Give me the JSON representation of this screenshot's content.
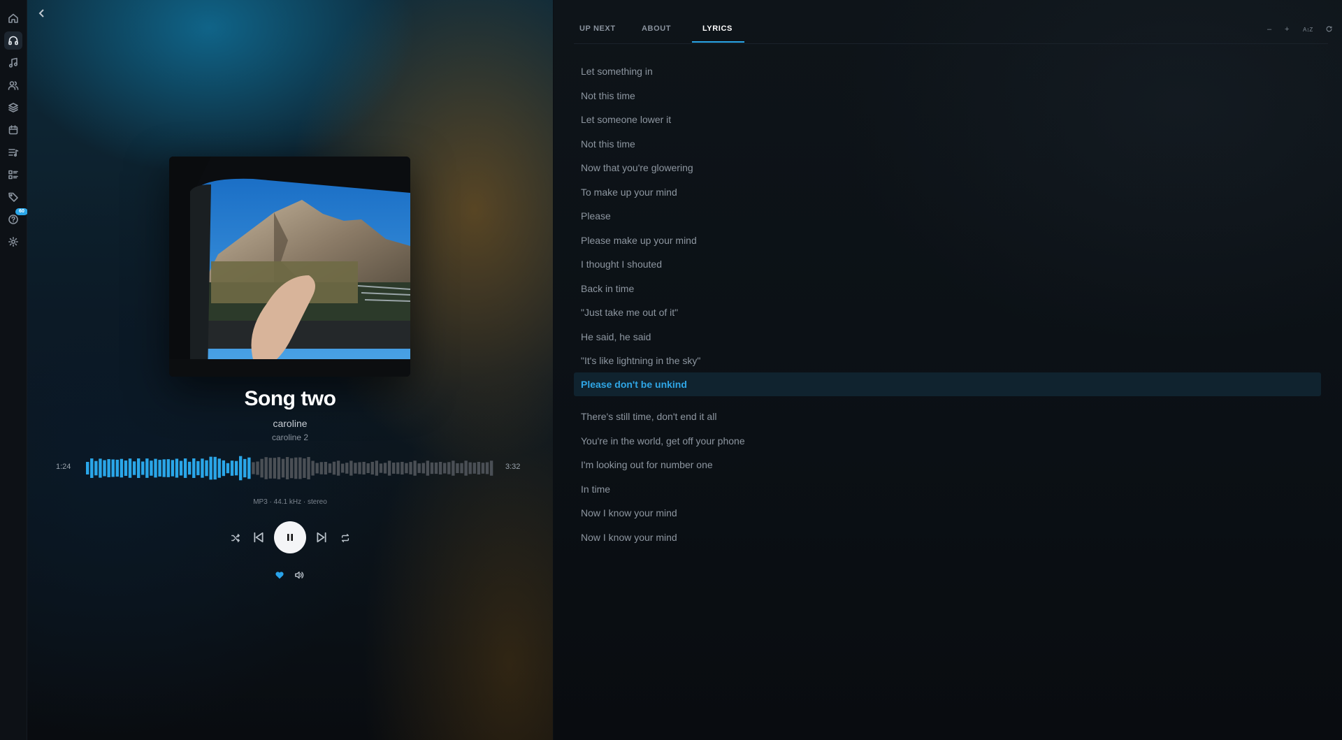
{
  "app": {
    "accent_color": "#2aa6e8",
    "rail_items": [
      {
        "icon": "home-icon"
      },
      {
        "icon": "headphones-icon",
        "active": true
      },
      {
        "icon": "music-note-icon"
      },
      {
        "icon": "users-icon"
      },
      {
        "icon": "layers-icon"
      },
      {
        "icon": "calendar-icon"
      },
      {
        "icon": "queue-icon"
      },
      {
        "icon": "grid-list-icon"
      },
      {
        "icon": "tag-icon"
      },
      {
        "icon": "help-icon",
        "badge": "60"
      },
      {
        "icon": "gear-icon"
      }
    ]
  },
  "player": {
    "title": "Song two",
    "artist": "caroline",
    "album": "caroline 2",
    "elapsed": "1:24",
    "duration": "3:32",
    "progress": 0.4,
    "format": "MP3 · 44.1 kHz · stereo",
    "liked": true,
    "state": "playing"
  },
  "lyrics_panel": {
    "tabs": [
      {
        "label": "UP NEXT"
      },
      {
        "label": "ABOUT"
      },
      {
        "label": "LYRICS",
        "active": true
      }
    ],
    "tools": {
      "minus": "–",
      "plus": "+",
      "az": "A↕Z"
    },
    "active_line": "Please don't be unkind",
    "lines_before": [
      "Let something in",
      "Not this time",
      "Let someone lower it",
      "Not this time",
      "Now that you're glowering",
      "To make up your mind",
      "Please",
      "Please make up your mind",
      "I thought I shouted",
      "Back in time",
      "\"Just take me out of it\"",
      "He said, he said",
      "\"It's like lightning in the sky\""
    ],
    "lines_after": [
      "There's still time, don't end it all",
      "You're in the world, get off your phone",
      "I'm looking out for number one",
      "In time",
      "Now I know your mind",
      "Now I know your mind"
    ]
  }
}
